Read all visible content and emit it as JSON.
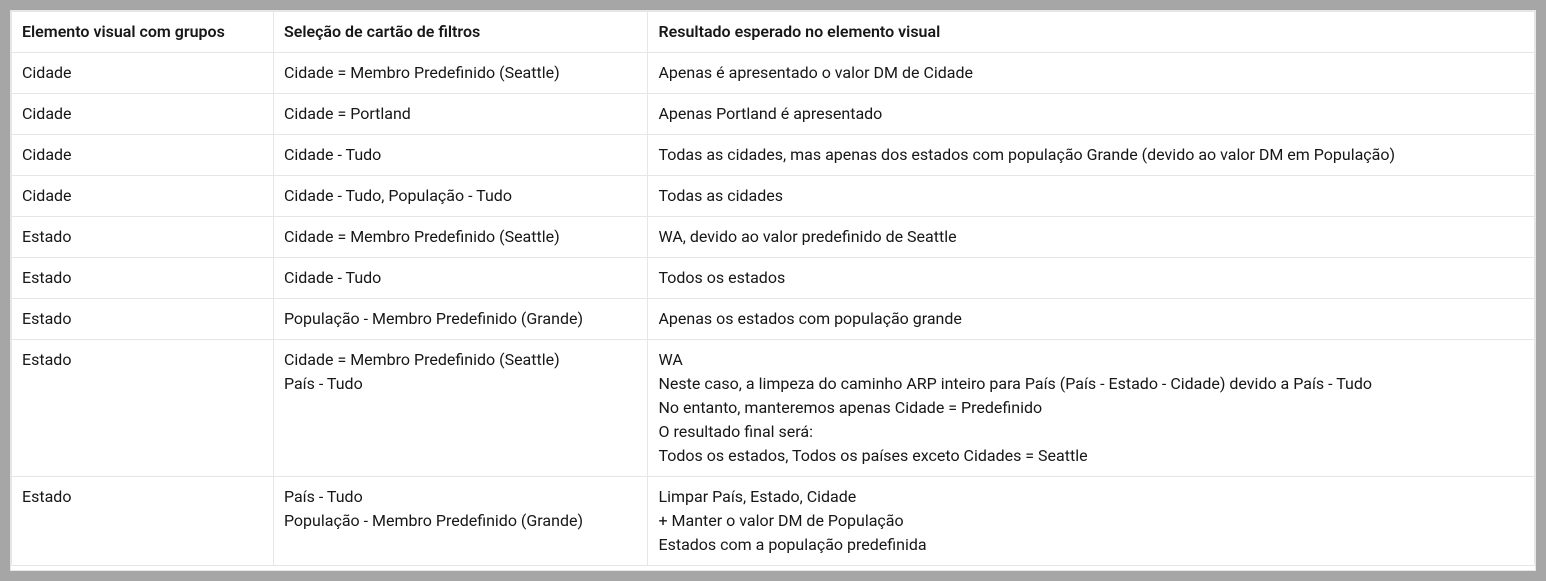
{
  "table": {
    "headers": [
      "Elemento visual com grupos",
      "Seleção de cartão de filtros",
      "Resultado esperado no elemento visual"
    ],
    "rows": [
      {
        "c0": [
          "Cidade"
        ],
        "c1": [
          "Cidade = Membro Predefinido (Seattle)"
        ],
        "c2": [
          "Apenas é apresentado o valor DM de Cidade"
        ]
      },
      {
        "c0": [
          "Cidade"
        ],
        "c1": [
          "Cidade = Portland"
        ],
        "c2": [
          "Apenas Portland é apresentado"
        ]
      },
      {
        "c0": [
          "Cidade"
        ],
        "c1": [
          "Cidade - Tudo"
        ],
        "c2": [
          "Todas as cidades, mas apenas dos estados com população Grande (devido ao valor DM em População)"
        ]
      },
      {
        "c0": [
          "Cidade"
        ],
        "c1": [
          "Cidade - Tudo, População - Tudo"
        ],
        "c2": [
          "Todas as cidades"
        ]
      },
      {
        "c0": [
          "Estado"
        ],
        "c1": [
          "Cidade = Membro Predefinido (Seattle)"
        ],
        "c2": [
          "WA, devido ao valor predefinido de Seattle"
        ]
      },
      {
        "c0": [
          "Estado"
        ],
        "c1": [
          "Cidade - Tudo"
        ],
        "c2": [
          "Todos os estados"
        ]
      },
      {
        "c0": [
          "Estado"
        ],
        "c1": [
          "População - Membro Predefinido (Grande)"
        ],
        "c2": [
          "Apenas os estados com população grande"
        ]
      },
      {
        "c0": [
          "Estado"
        ],
        "c1": [
          "Cidade = Membro Predefinido (Seattle)",
          "País - Tudo"
        ],
        "c2": [
          "WA",
          "Neste caso, a limpeza do caminho ARP inteiro para País (País - Estado - Cidade) devido a País - Tudo",
          "No entanto, manteremos apenas Cidade = Predefinido",
          "O resultado final será:",
          "Todos os estados, Todos os países exceto Cidades = Seattle"
        ]
      },
      {
        "c0": [
          "Estado"
        ],
        "c1": [
          "País - Tudo",
          "População - Membro Predefinido (Grande)"
        ],
        "c2": [
          "Limpar País, Estado, Cidade",
          "+ Manter o valor DM de População",
          "Estados com a população predefinida"
        ]
      }
    ]
  }
}
